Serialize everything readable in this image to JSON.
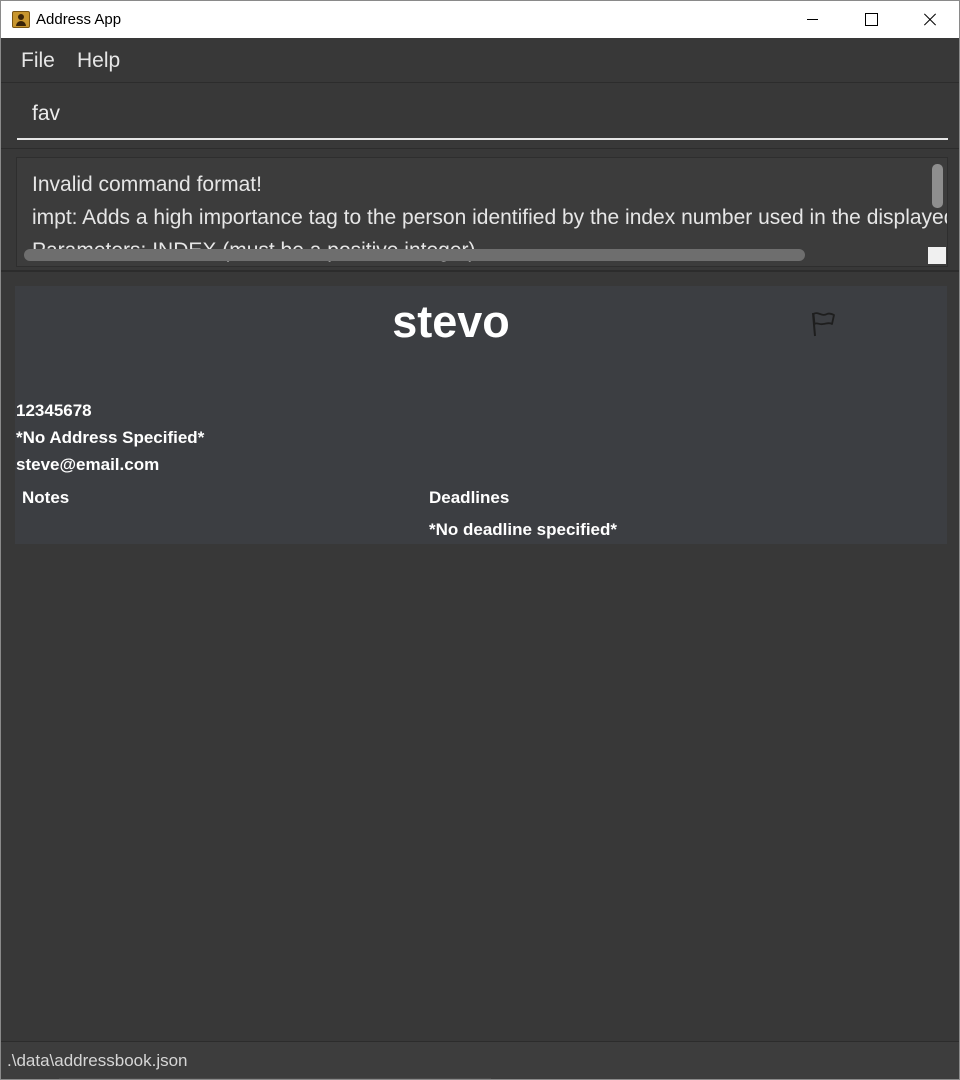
{
  "window": {
    "title": "Address App",
    "icon": "address-book-icon"
  },
  "menu": {
    "items": [
      "File",
      "Help"
    ]
  },
  "command": {
    "value": "fav"
  },
  "result": {
    "lines": [
      "Invalid command format!",
      "impt: Adds a high importance tag to the person identified by the index number used in the displayed person list.",
      "Parameters: INDEX (must be a positive integer)"
    ]
  },
  "person": {
    "name": "stevo",
    "phone": "12345678",
    "address": "*No Address Specified*",
    "email": "steve@email.com",
    "notes_label": "Notes",
    "deadlines_label": "Deadlines",
    "deadline_value": "*No deadline specified*",
    "flag_icon": "flag-icon"
  },
  "status": {
    "save_location": ".\\data\\addressbook.json"
  },
  "colors": {
    "background": "#383838",
    "card": "#3c3e42",
    "text": "#ffffff"
  }
}
